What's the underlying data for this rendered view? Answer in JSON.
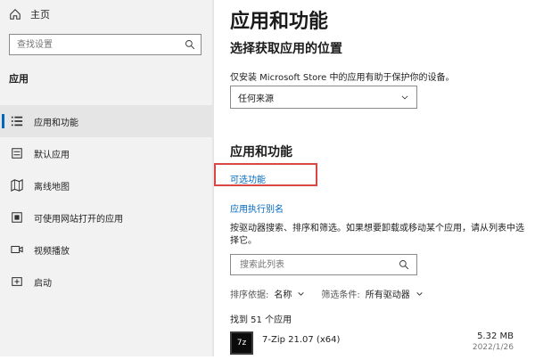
{
  "sidebar": {
    "home_label": "主页",
    "search_placeholder": "查找设置",
    "section_label": "应用",
    "items": [
      {
        "label": "应用和功能",
        "active": true,
        "icon": "apps-list-icon"
      },
      {
        "label": "默认应用",
        "active": false,
        "icon": "default-apps-icon"
      },
      {
        "label": "离线地图",
        "active": false,
        "icon": "map-icon"
      },
      {
        "label": "可使用网站打开的应用",
        "active": false,
        "icon": "open-with-icon"
      },
      {
        "label": "视频播放",
        "active": false,
        "icon": "video-icon"
      },
      {
        "label": "启动",
        "active": false,
        "icon": "startup-icon"
      }
    ]
  },
  "content": {
    "title": "应用和功能",
    "choose_location_title": "选择获取应用的位置",
    "choose_location_desc": "仅安装 Microsoft Store 中的应用有助于保护你的设备。",
    "source_dropdown_value": "任何来源",
    "section_title": "应用和功能",
    "optional_features_link": "可选功能",
    "app_alias_link": "应用执行别名",
    "instructions": "按驱动器搜索、排序和筛选。如果想要卸载或移动某个应用，请从列表中选择它。",
    "list_search_placeholder": "搜索此列表",
    "sort_label": "排序依据:",
    "sort_value": "名称",
    "filter_label": "筛选条件:",
    "filter_value": "所有驱动器",
    "found_count": "找到 51 个应用",
    "apps": [
      {
        "name": "7-Zip 21.07 (x64)",
        "size": "5.32 MB",
        "date": "2022/1/26",
        "icon_text": "7z"
      }
    ]
  },
  "colors": {
    "accent": "#0067c0",
    "highlight": "#d94747",
    "sidebar_bg": "#f2f2f2"
  }
}
